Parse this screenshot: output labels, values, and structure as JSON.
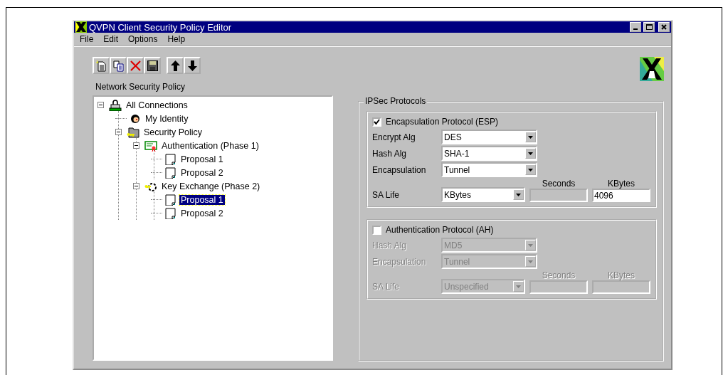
{
  "window": {
    "title": "QVPN Client Security Policy Editor"
  },
  "menu": [
    "File",
    "Edit",
    "Options",
    "Help"
  ],
  "toolbar": {
    "groups": [
      [
        {
          "kind": "new"
        },
        {
          "kind": "copy"
        },
        {
          "kind": "delete"
        },
        {
          "kind": "save"
        }
      ],
      [
        {
          "kind": "up"
        },
        {
          "kind": "down"
        }
      ]
    ],
    "caption": "Network Security Policy"
  },
  "tree": [
    {
      "label": "All Connections",
      "kind": "connections",
      "expanded": true,
      "selected": false,
      "children": [
        {
          "label": "My Identity",
          "kind": "identity",
          "selected": false
        },
        {
          "label": "Security Policy",
          "kind": "policy",
          "expanded": true,
          "selected": false,
          "children": [
            {
              "label": "Authentication (Phase 1)",
              "kind": "certificate",
              "expanded": true,
              "selected": false,
              "children": [
                {
                  "label": "Proposal 1",
                  "kind": "proposal",
                  "selected": false
                },
                {
                  "label": "Proposal 2",
                  "kind": "proposal",
                  "selected": false
                }
              ]
            },
            {
              "label": "Key Exchange (Phase 2)",
              "kind": "keys",
              "expanded": true,
              "selected": false,
              "children": [
                {
                  "label": "Proposal 1",
                  "kind": "proposal",
                  "selected": true
                },
                {
                  "label": "Proposal 2",
                  "kind": "proposal",
                  "selected": false
                }
              ]
            }
          ]
        }
      ]
    }
  ],
  "ipsec": {
    "title": "IPSec Protocols",
    "protocols": [
      {
        "label": "Encapsulation Protocol (ESP)",
        "checked": true,
        "fields": [
          {
            "label": "Encrypt Alg",
            "value": "DES"
          },
          {
            "label": "Hash Alg",
            "value": "SHA-1"
          },
          {
            "label": "Encapsulation",
            "value": "Tunnel"
          }
        ],
        "life": {
          "label": "SA Life",
          "value": "KBytes",
          "seconds": {
            "heading": "Seconds",
            "enabled": false
          },
          "kbytes": {
            "heading": "KBytes",
            "value": "4096",
            "enabled": true
          }
        }
      },
      {
        "label": "Authentication Protocol (AH)",
        "checked": false,
        "fields": [
          {
            "label": "Hash Alg",
            "value": "MD5"
          },
          {
            "label": "Encapsulation",
            "value": "Tunnel"
          }
        ],
        "life": {
          "label": "SA Life",
          "value": "Unspecified",
          "seconds": {
            "heading": "Seconds",
            "enabled": false
          },
          "kbytes": {
            "heading": "KBytes",
            "enabled": false
          }
        }
      }
    ]
  }
}
